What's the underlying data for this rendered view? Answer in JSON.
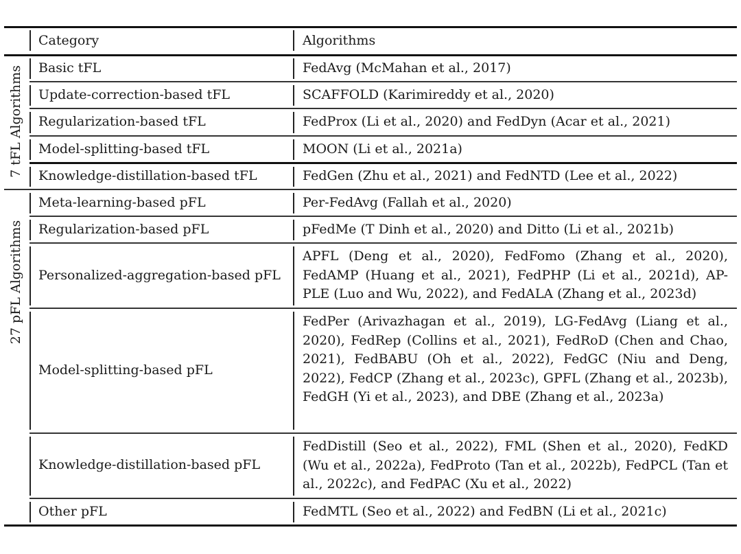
{
  "table": {
    "header": {
      "category": "Category",
      "algorithms": "Algorithms"
    },
    "groups": [
      {
        "label": "7 tFL Algorithms",
        "rows": [
          {
            "category": "Basic tFL",
            "algorithms": "FedAvg (McMahan et al., 2017)"
          },
          {
            "category": "Update-correction-based tFL",
            "algorithms": "SCAFFOLD (Karimireddy et al., 2020)"
          },
          {
            "category": "Regularization-based tFL",
            "algorithms": "FedProx (Li et al., 2020) and FedDyn (Acar et al., 2021)"
          },
          {
            "category": "Model-splitting-based tFL",
            "algorithms": "MOON (Li et al., 2021a)"
          },
          {
            "category": "Knowledge-distillation-based tFL",
            "algorithms": "FedGen (Zhu et al., 2021) and FedNTD (Lee et al., 2022)"
          }
        ]
      },
      {
        "label": "27 pFL Algorithms",
        "rows": [
          {
            "category": "Meta-learning-based pFL",
            "algorithms": "Per-FedAvg (Fallah et al., 2020)"
          },
          {
            "category": "Regularization-based pFL",
            "algorithms": "pFedMe (T Dinh et al., 2020) and Ditto (Li et al., 2021b)"
          },
          {
            "category": "Personalized-aggregation-based pFL",
            "algorithms": "APFL (Deng et al., 2020), FedFomo (Zhang et al., 2020), FedAMP (Huang et al., 2021), FedPHP (Li et al., 2021d), AP-PLE (Luo and Wu, 2022), and FedALA (Zhang et al., 2023d)"
          },
          {
            "category": "Model-splitting-based pFL",
            "algorithms": "FedPer (Arivazhagan et al., 2019), LG-FedAvg (Liang et al., 2020), FedRep (Collins et al., 2021), FedRoD (Chen and Chao, 2021), FedBABU (Oh et al., 2022), FedGC (Niu and Deng, 2022), FedCP (Zhang et al., 2023c), GPFL (Zhang et al., 2023b), FedGH (Yi et al., 2023), and DBE (Zhang et al., 2023a)"
          },
          {
            "category": "Knowledge-distillation-based pFL",
            "algorithms": "FedDistill (Seo et al., 2022), FML (Shen et al., 2020), FedKD (Wu et al., 2022a), FedProto (Tan et al., 2022b), FedPCL (Tan et al., 2022c), and FedPAC (Xu et al., 2022)"
          },
          {
            "category": "Other pFL",
            "algorithms": "FedMTL (Seo et al., 2022) and FedBN (Li et al., 2021c)"
          }
        ]
      }
    ]
  }
}
